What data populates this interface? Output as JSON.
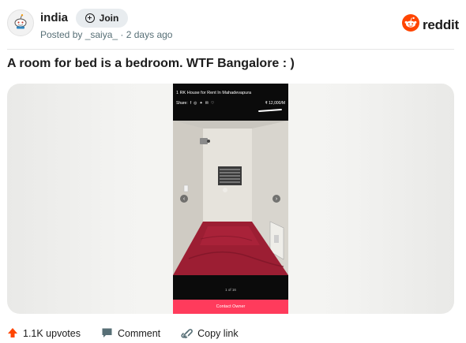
{
  "post": {
    "subreddit": "india",
    "join_label": "Join",
    "posted_by_prefix": "Posted by ",
    "author": "_saiya_",
    "separator": " · ",
    "time": "2 days ago",
    "brand": "reddit",
    "title": "A room for bed is a bedroom. WTF Bangalore : )"
  },
  "media": {
    "listing_title": "1 RK House for Rent In Mahadevapura",
    "share_label": "Share:",
    "price": "₹ 12,000/M",
    "pager": "1 of 16",
    "contact_label": "Contact Owner"
  },
  "actions": {
    "upvotes": "1.1K upvotes",
    "comment": "Comment",
    "copy_link": "Copy link"
  },
  "colors": {
    "reddit_orange": "#ff4500",
    "upvote": "#ff4500",
    "contact_button": "#ff3b5c",
    "meta_text": "#576f76"
  },
  "icons": [
    "snoo-avatar-icon",
    "plus-circle-icon",
    "reddit-logo-icon",
    "upvote-arrow-icon",
    "comment-icon",
    "link-icon",
    "facebook-icon",
    "whatsapp-icon",
    "twitter-icon",
    "email-icon",
    "heart-icon",
    "chevron-left-icon",
    "chevron-right-icon"
  ]
}
